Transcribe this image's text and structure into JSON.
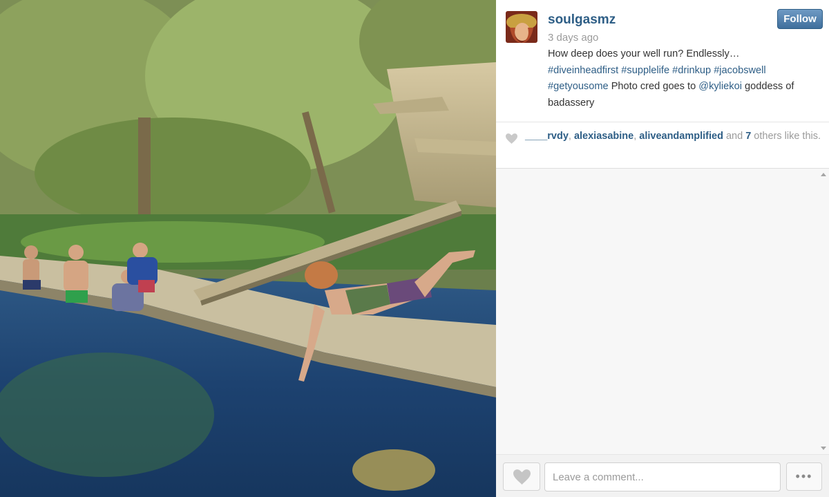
{
  "post": {
    "username": "soulgasmz",
    "timestamp": "3 days ago",
    "follow_label": "Follow",
    "caption": {
      "line1": "How deep does your well run? Endlessly…",
      "tags": [
        "#diveinheadfirst",
        "#supplelife",
        "#drinkup",
        "#jacobswell",
        "#getyousome"
      ],
      "text2": "Photo cred goes to",
      "mention": "@kyliekoi",
      "text3": "goddess of badassery"
    },
    "photo_description_icon": "photo"
  },
  "likes": {
    "users": [
      "____rvdy",
      "alexiasabine",
      "aliveandamplified"
    ],
    "sep1": ", ",
    "sep2": ", ",
    "and_text": " and ",
    "others_count": "7",
    "others_text": " others like this."
  },
  "comment_box": {
    "placeholder": "Leave a comment...",
    "more_label": "•••"
  },
  "colors": {
    "link": "#2e5e86",
    "muted": "#9b9b9b",
    "follow_bg": "#4a78a6"
  }
}
